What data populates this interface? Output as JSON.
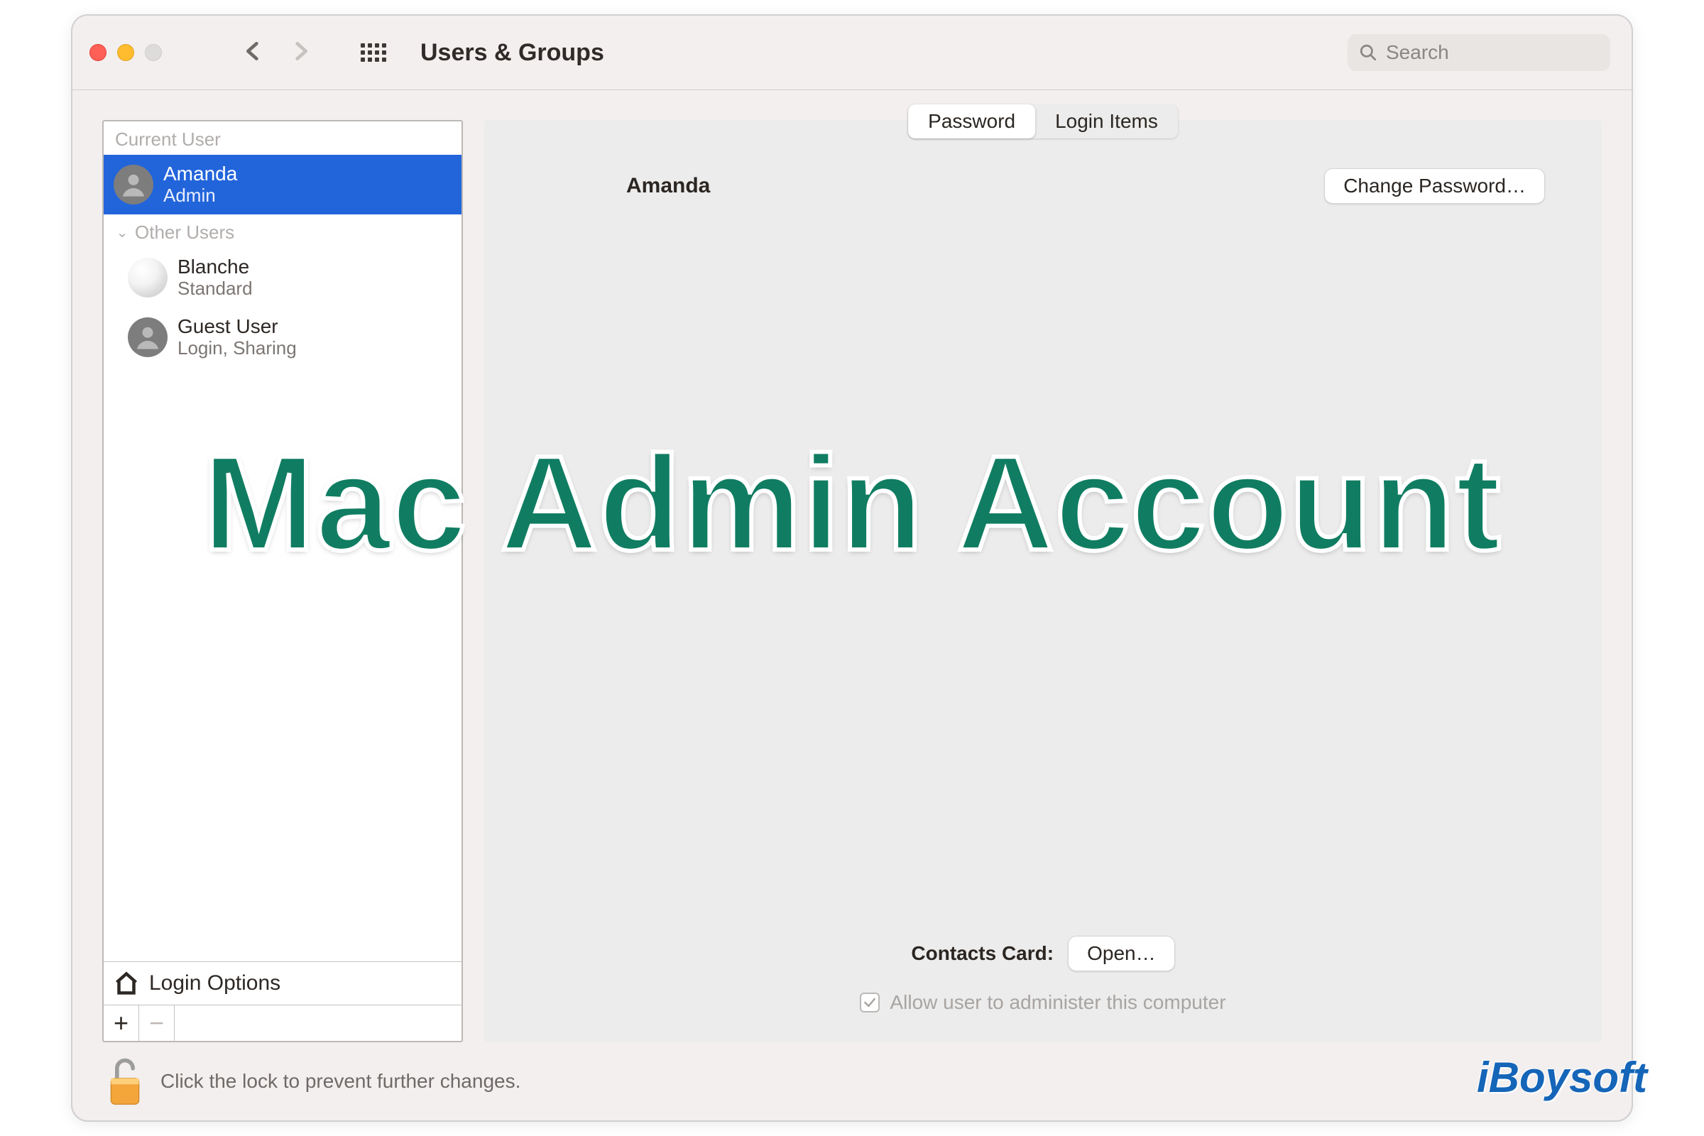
{
  "window": {
    "title": "Users & Groups"
  },
  "search": {
    "placeholder": "Search"
  },
  "sidebar": {
    "current_user_header": "Current User",
    "other_users_header": "Other Users",
    "current": {
      "name": "Amanda",
      "role": "Admin"
    },
    "others": [
      {
        "name": "Blanche",
        "role": "Standard"
      },
      {
        "name": "Guest User",
        "role": "Login, Sharing"
      }
    ],
    "login_options_label": "Login Options"
  },
  "tabs": {
    "password": "Password",
    "login_items": "Login Items"
  },
  "main": {
    "user_display_name": "Amanda",
    "change_password_label": "Change Password…",
    "contacts_label": "Contacts Card:",
    "open_label": "Open…",
    "allow_admin_label": "Allow user to administer this computer",
    "allow_admin_checked": true
  },
  "footer": {
    "lock_text": "Click the lock to prevent further changes."
  },
  "overlay": {
    "title": "Mac Admin Account"
  },
  "watermark": {
    "text": "iBoysoft"
  }
}
